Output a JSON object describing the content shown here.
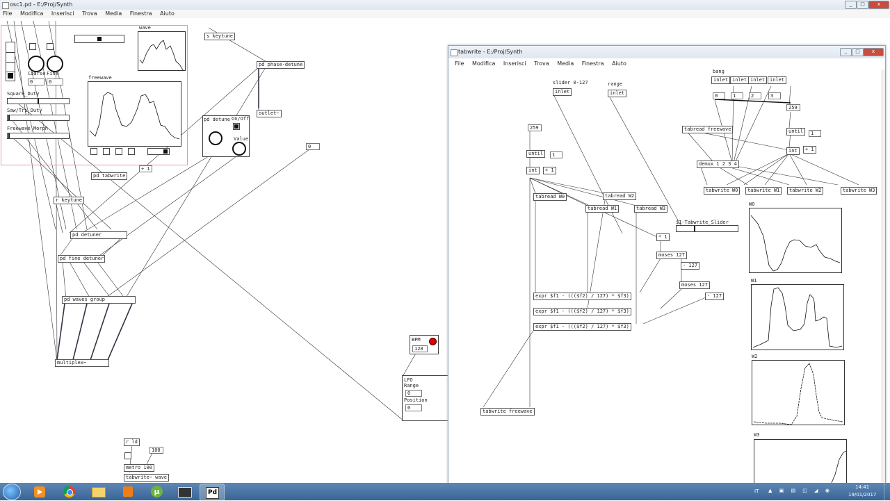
{
  "main_window": {
    "title": "osc1.pd - E:/Proj/Synth",
    "menu": [
      "File",
      "Modifica",
      "Inserisci",
      "Trova",
      "Media",
      "Finestra",
      "Aiuto"
    ]
  },
  "sub_window": {
    "title": "tabwrite - E:/Proj/Synth",
    "menu": [
      "File",
      "Modifica",
      "Inserisci",
      "Trova",
      "Media",
      "Finestra",
      "Aiuto"
    ]
  },
  "window_buttons": {
    "minimize": "_",
    "maximize": "□",
    "close": "x"
  },
  "left_patch": {
    "knob_labels": {
      "coarse": "Coarse",
      "fine": "Fine"
    },
    "knob_values": {
      "coarse": "0",
      "fine": "0"
    },
    "wave_label": "wave",
    "freewave_label": "freewave",
    "sliders": [
      "Square_Duty",
      "Saw/Tri_Duty",
      "Freewave_Morph"
    ],
    "objects": {
      "s_keytune": "s keytune",
      "pd_phase_detune": "pd phase-detune",
      "outlet": "outlet~",
      "pd_detune": "pd detune",
      "on_off": "On/Off",
      "value": "Value",
      "zero_num": "0",
      "pd_tabwrite": "pd tabwrite",
      "plus_one": "+ 1",
      "r_keytune": "r keytune",
      "pd_detuner": "pd detuner",
      "pd_fine_detuner": "pd fine detuner",
      "pd_waves_group": "pd waves group",
      "multiplex": "multiplex~",
      "bpm": "BPM",
      "bpm_value": "120",
      "lfo": "LFO",
      "range": "Range",
      "range_value": "0",
      "position": "Position",
      "position_value": "0",
      "r_ld": "r ld",
      "hundred": "100",
      "metro": "metro 100",
      "tabwrite_wave": "tabwrite~ wave"
    }
  },
  "right_patch": {
    "labels": {
      "slider": "slider 0-127",
      "range": "range",
      "bang": "bang",
      "w0": "W0",
      "w1": "W1",
      "w2": "W2",
      "w3": "W3",
      "slider_name": "$1-Tabwrite_Slider"
    },
    "objects": {
      "inlet": "inlet",
      "n259": "259",
      "until": "until",
      "one": "1",
      "int": "int",
      "plus1": "+ 1",
      "tabread_w0": "tabread W0",
      "tabread_w1": "tabread W1",
      "tabread_w2": "tabread W2",
      "tabread_w3": "tabread W3",
      "tabread_freewave": "tabread freewave",
      "demux": "demux 1 2 3 4",
      "tabwrite_w0": "tabwrite W0",
      "tabwrite_w1": "tabwrite W1",
      "tabwrite_w2": "tabwrite W2",
      "tabwrite_w3": "tabwrite W3",
      "times1": "* 1",
      "moses127": "moses 127",
      "minus127": "- 127",
      "moses127b": "moses 127",
      "minus127b": "- 127",
      "expr": "expr $f1 - ((($f2) / 127) * $f3)",
      "tabwrite_freewave": "tabwrite freewave",
      "zero": "0",
      "n1": "1",
      "n2": "2",
      "n3": "3"
    }
  },
  "taskbar": {
    "lang": "IT",
    "time": "14:41",
    "date": "19/01/2017",
    "apps": [
      "start-orb",
      "media-player",
      "chrome",
      "explorer",
      "vlc",
      "utorrent",
      "video-editor",
      "pure-data"
    ]
  }
}
